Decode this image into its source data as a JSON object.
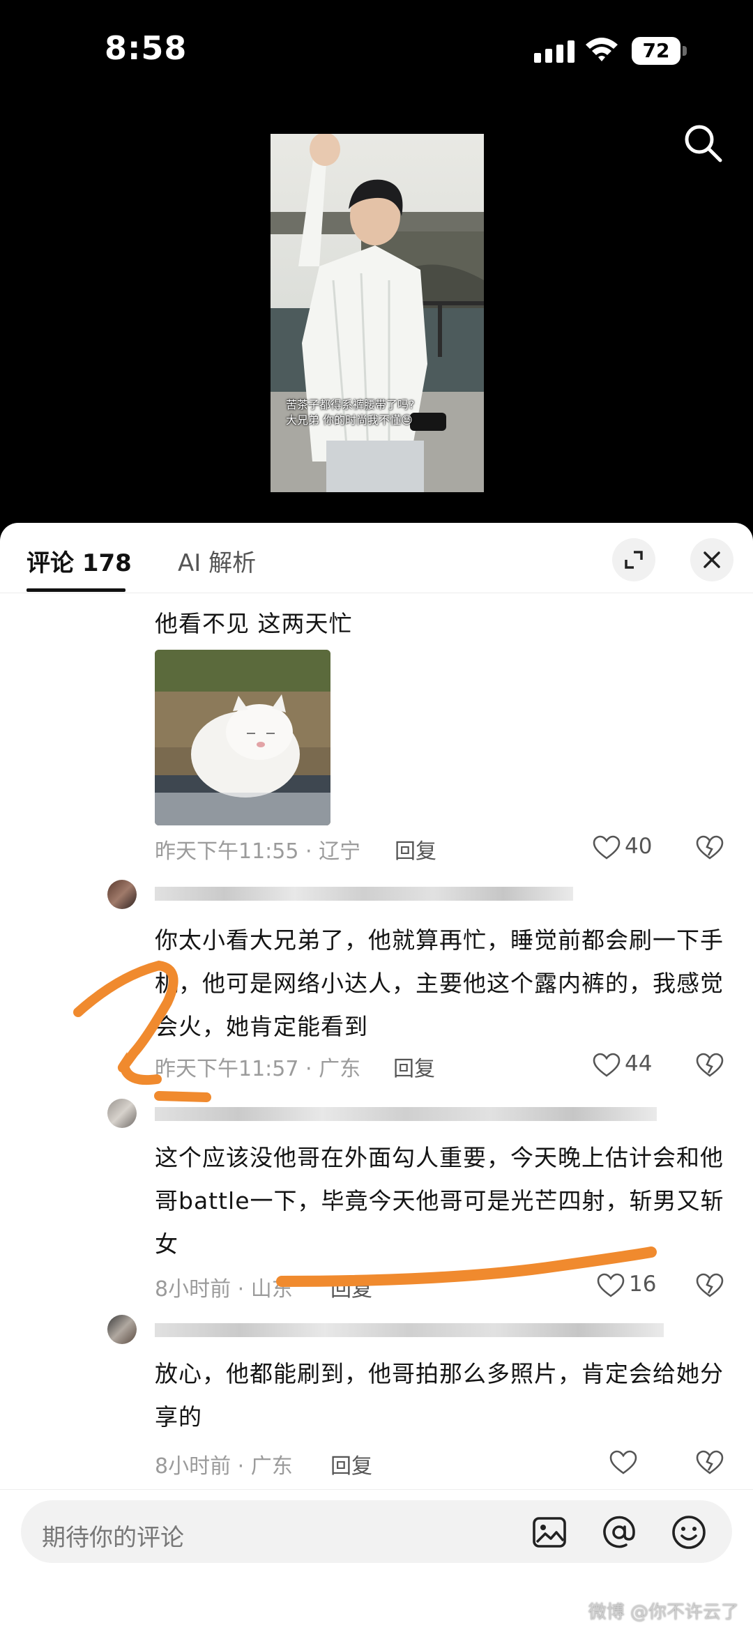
{
  "status_bar": {
    "time": "8:58",
    "battery": "72"
  },
  "video": {
    "caption_line1": "苦茶子都得系裤腰带了吗?",
    "caption_line2": "大兄弟 你的时尚我不懂😓"
  },
  "comments_panel": {
    "tabs": [
      {
        "label": "评论 178"
      },
      {
        "label": "AI 解析"
      }
    ],
    "comments": [
      {
        "text": "他看不见 这两天忙",
        "has_sticker": true,
        "time_location": "昨天下午11:55 · 辽宁",
        "reply_label": "回复",
        "likes": "40"
      },
      {
        "text": "你太小看大兄弟了，他就算再忙，睡觉前都会刷一下手机，他可是网络小达人，主要他这个露内裤的，我感觉会火，她肯定能看到",
        "time_location": "昨天下午11:57 · 广东",
        "reply_label": "回复",
        "likes": "44"
      },
      {
        "text": "这个应该没他哥在外面勾人重要，今天晚上估计会和他哥battle一下，毕竟今天他哥可是光芒四射，斩男又斩女",
        "time_location": "8小时前 · 山东",
        "reply_label": "回复",
        "likes": "16"
      },
      {
        "text": "放心，他都能刷到，他哥拍那么多照片，肯定会给她分享的",
        "time_location": "8小时前 · 广东",
        "reply_label": "回复",
        "likes": ""
      }
    ]
  },
  "input_bar": {
    "placeholder": "期待你的评论"
  },
  "watermark": "微博 @你不许云了",
  "colors": {
    "annotation": "#f08a2e",
    "background_dark": "#000000",
    "panel": "#ffffff"
  },
  "icons": [
    "search-icon",
    "expand-icon",
    "close-icon",
    "heart-icon",
    "broken-heart-icon",
    "image-icon",
    "at-icon",
    "emoji-icon"
  ]
}
